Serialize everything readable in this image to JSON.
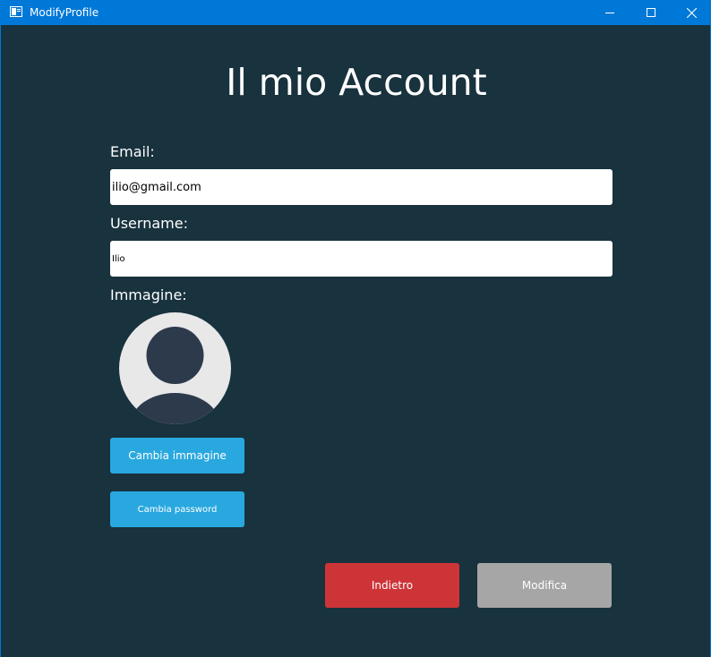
{
  "window": {
    "title": "ModifyProfile"
  },
  "page": {
    "title": "Il mio Account"
  },
  "form": {
    "email_label": "Email:",
    "email_value": "ilio@gmail.com",
    "username_label": "Username:",
    "username_value": "Ilio",
    "image_label": "Immagine:"
  },
  "buttons": {
    "change_image": "Cambia immagine",
    "change_password": "Cambia password",
    "back": "Indietro",
    "modify": "Modifica"
  },
  "icons": {
    "app": "app-window-icon",
    "minimize": "minimize-icon",
    "maximize": "maximize-icon",
    "close": "close-icon",
    "avatar": "user-avatar-icon"
  },
  "colors": {
    "titlebar": "#0078d7",
    "background": "#18323e",
    "primary_button": "#29a8e0",
    "back_button": "#cd3438",
    "modify_button": "#a6a6a6"
  }
}
